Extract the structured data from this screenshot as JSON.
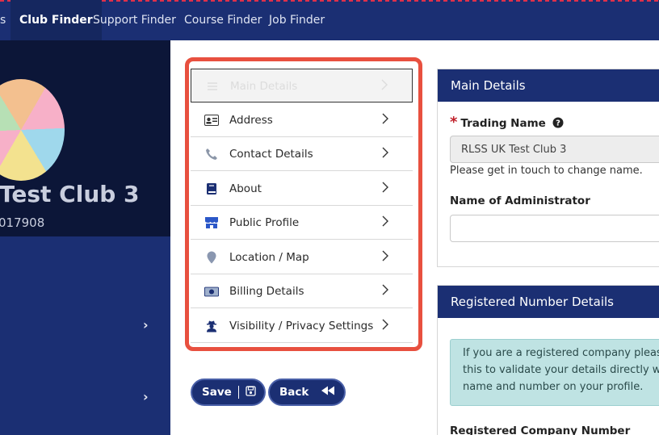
{
  "nav": {
    "partial": "s",
    "items": [
      {
        "label": "Club Finder",
        "active": true
      },
      {
        "label": "Support Finder",
        "active": false
      },
      {
        "label": "Course Finder",
        "active": false
      },
      {
        "label": "Job Finder",
        "active": false
      }
    ]
  },
  "profile": {
    "club_name": "Test Club 3",
    "club_number": "017908"
  },
  "menu": {
    "items": [
      {
        "label": "Main Details",
        "icon": "list-icon",
        "active": true
      },
      {
        "label": "Address",
        "icon": "id-card-icon",
        "active": false
      },
      {
        "label": "Contact Details",
        "icon": "phone-icon",
        "active": false
      },
      {
        "label": "About",
        "icon": "book-icon",
        "active": false
      },
      {
        "label": "Public Profile",
        "icon": "store-icon",
        "active": false
      },
      {
        "label": "Location / Map",
        "icon": "map-pin-icon",
        "active": false
      },
      {
        "label": "Billing Details",
        "icon": "money-icon",
        "active": false
      },
      {
        "label": "Visibility / Privacy Settings",
        "icon": "user-secret-icon",
        "active": false
      }
    ]
  },
  "buttons": {
    "save_label": "Save",
    "back_label": "Back"
  },
  "main_details": {
    "title": "Main Details",
    "trading_name_label": "Trading Name",
    "trading_name_value": "RLSS UK Test Club 3",
    "trading_name_help": "Please get in touch to change name.",
    "administrator_label": "Name of Administrator",
    "administrator_value": ""
  },
  "registered": {
    "title": "Registered Number Details",
    "info_line1": "If you are a registered company please e",
    "info_line2": "this to validate your details directly with",
    "info_line3": "name and number on your profile.",
    "company_number_label": "Registered Company Number"
  },
  "colors": {
    "nav_bg": "#1b2f73",
    "accent_red": "#e8503f",
    "info_bg": "#bfe3e3"
  }
}
